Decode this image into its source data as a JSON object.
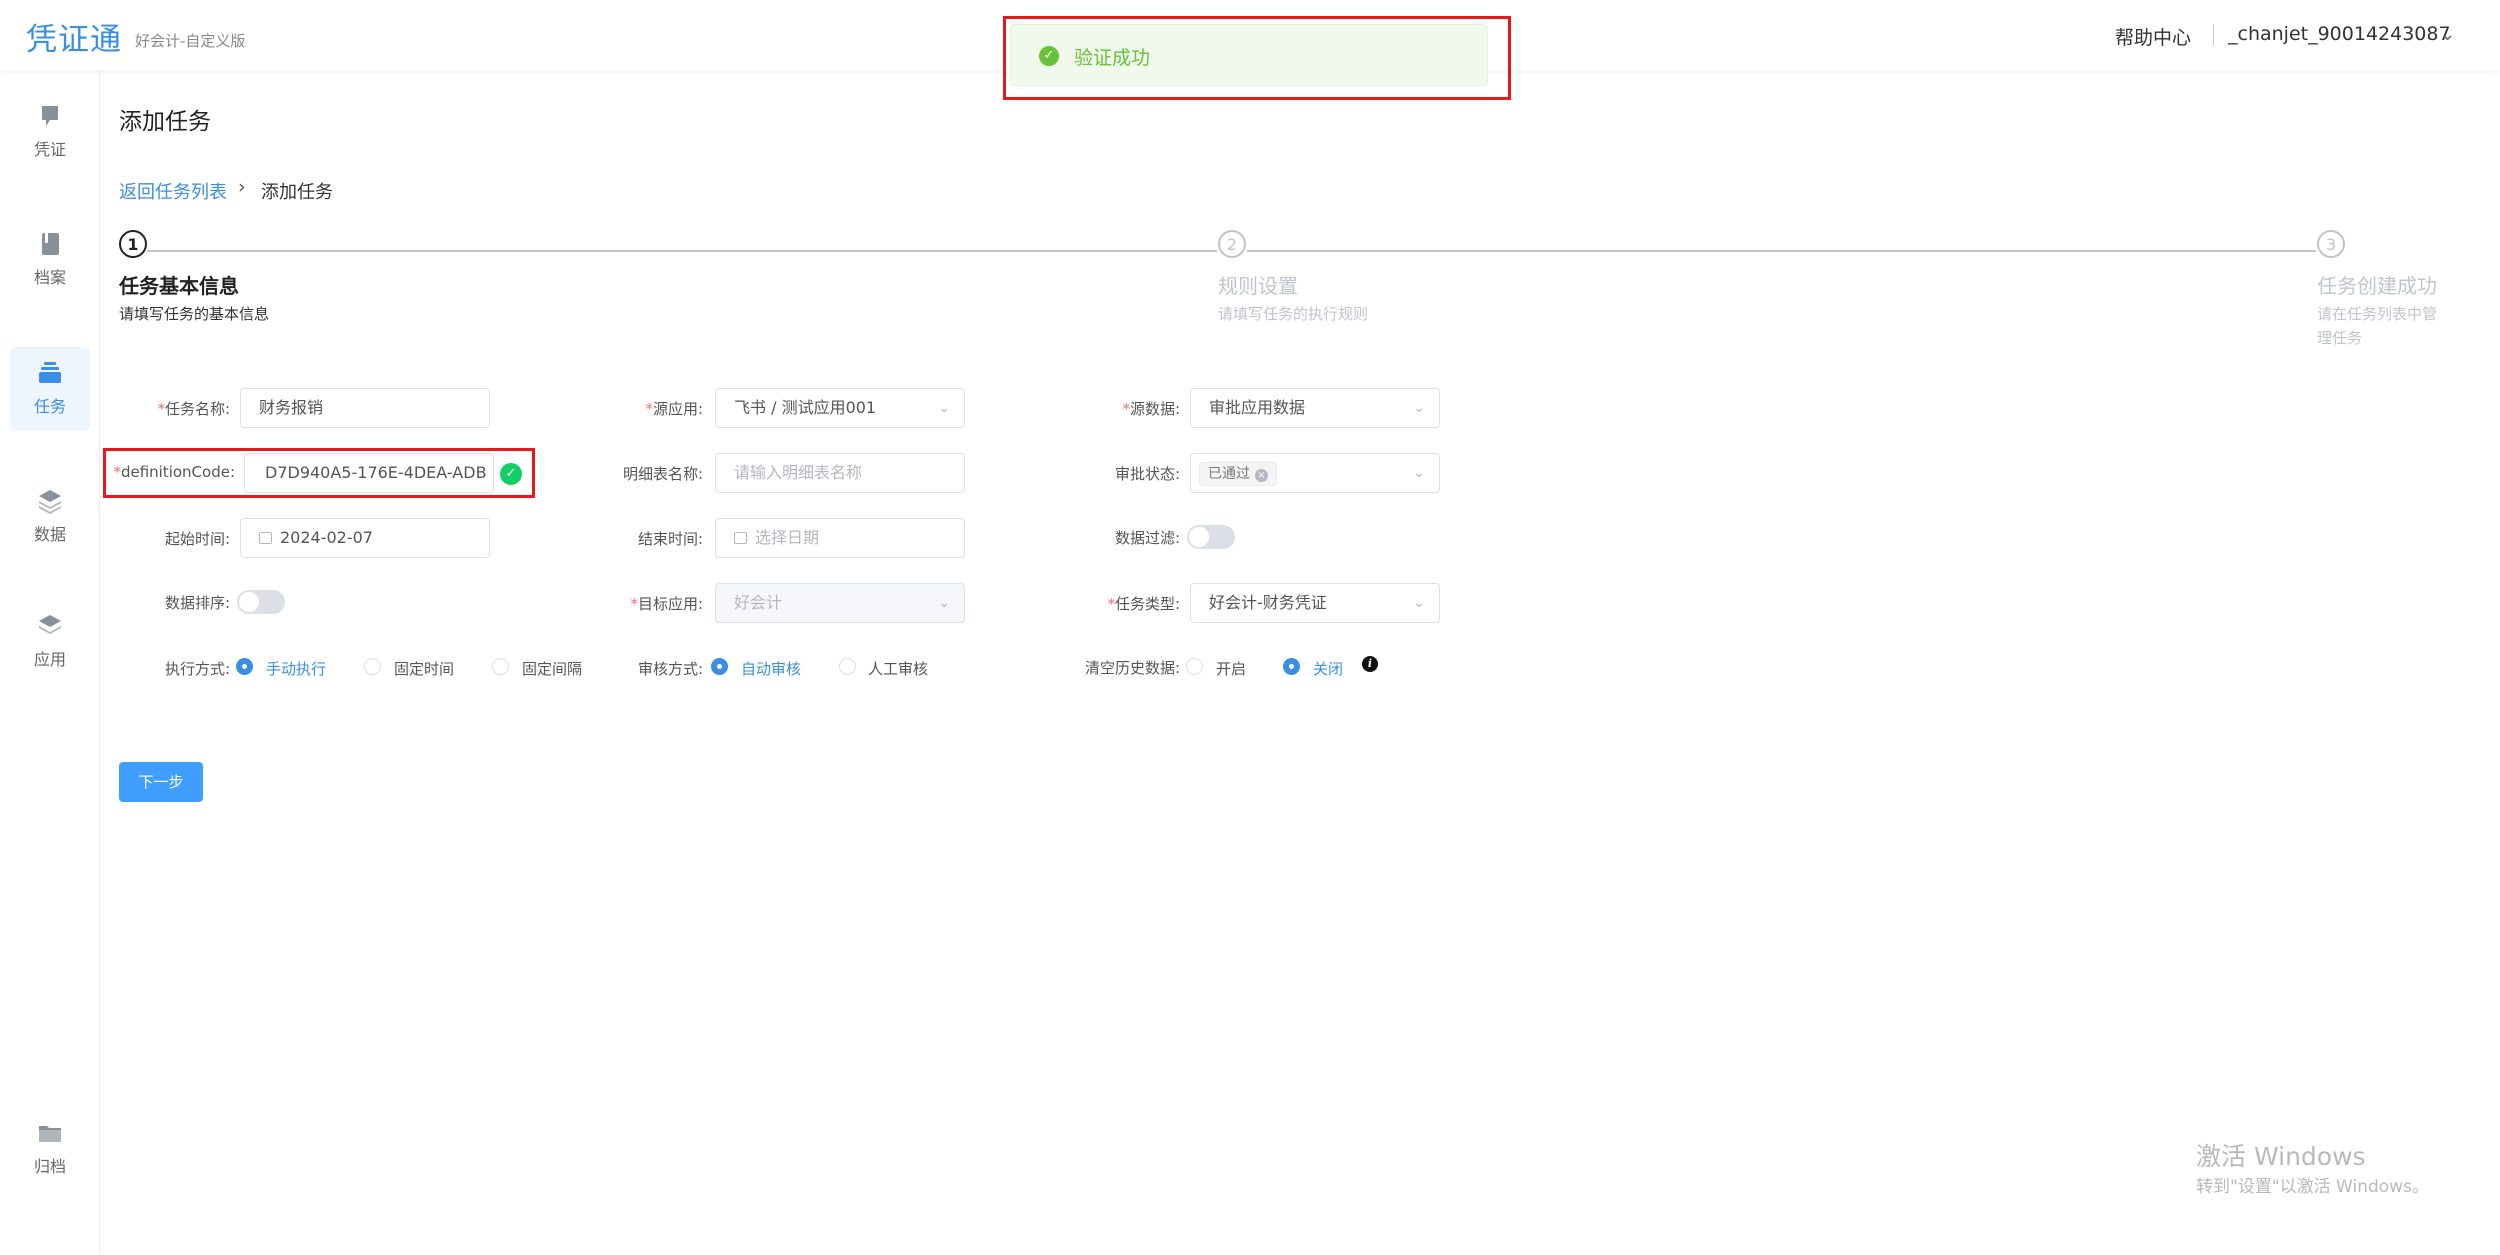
{
  "header": {
    "logo": "凭证通",
    "edition": "好会计-自定义版",
    "help": "帮助中心",
    "user": "_chanjet_90014243087"
  },
  "toast": {
    "message": "验证成功"
  },
  "sidebar": {
    "items": [
      {
        "label": "凭证",
        "icon": "voucher-icon"
      },
      {
        "label": "档案",
        "icon": "archive-book-icon"
      },
      {
        "label": "任务",
        "icon": "task-stack-icon",
        "active": true
      },
      {
        "label": "数据",
        "icon": "data-layers-icon"
      },
      {
        "label": "应用",
        "icon": "app-layers-icon"
      },
      {
        "label": "归档",
        "icon": "folder-icon"
      }
    ]
  },
  "page": {
    "title": "添加任务",
    "breadcrumb_back": "返回任务列表",
    "breadcrumb_current": "添加任务"
  },
  "steps": [
    {
      "num": "1",
      "title": "任务基本信息",
      "desc": "请填写任务的基本信息",
      "state": "active"
    },
    {
      "num": "2",
      "title": "规则设置",
      "desc": "请填写任务的执行规则",
      "state": "todo"
    },
    {
      "num": "3",
      "title": "任务创建成功",
      "desc_line1": "请在任务列表中管",
      "desc_line2": "理任务",
      "state": "todo"
    }
  ],
  "form": {
    "task_name": {
      "label": "任务名称:",
      "value": "财务报销"
    },
    "source_app": {
      "label": "源应用:",
      "value": "飞书 / 测试应用001"
    },
    "source_data": {
      "label": "源数据:",
      "value": "审批应用数据"
    },
    "definition_code": {
      "label": "definitionCode:",
      "value": "D7D940A5-176E-4DEA-ADB"
    },
    "detail_table": {
      "label": "明细表名称:",
      "placeholder": "请输入明细表名称"
    },
    "approval_status": {
      "label": "审批状态:",
      "tag": "已通过"
    },
    "start_time": {
      "label": "起始时间:",
      "value": "2024-02-07"
    },
    "end_time": {
      "label": "结束时间:",
      "placeholder": "选择日期"
    },
    "data_filter": {
      "label": "数据过滤:",
      "on": false
    },
    "data_sort": {
      "label": "数据排序:",
      "on": false
    },
    "target_app": {
      "label": "目标应用:",
      "value": "好会计"
    },
    "task_type": {
      "label": "任务类型:",
      "value": "好会计-财务凭证"
    },
    "exec_mode": {
      "label": "执行方式:",
      "options": [
        "手动执行",
        "固定时间",
        "固定间隔"
      ],
      "selected": "手动执行"
    },
    "review_mode": {
      "label": "审核方式:",
      "options": [
        "自动审核",
        "人工审核"
      ],
      "selected": "自动审核"
    },
    "clear_history": {
      "label": "清空历史数据:",
      "options": [
        "开启",
        "关闭"
      ],
      "selected": "关闭"
    }
  },
  "actions": {
    "next": "下一步"
  },
  "watermark": {
    "line1": "激活 Windows",
    "line2": "转到\"设置\"以激活 Windows。"
  },
  "colors": {
    "primary": "#409eff",
    "success": "#67c23a",
    "highlight": "#e8191c"
  }
}
